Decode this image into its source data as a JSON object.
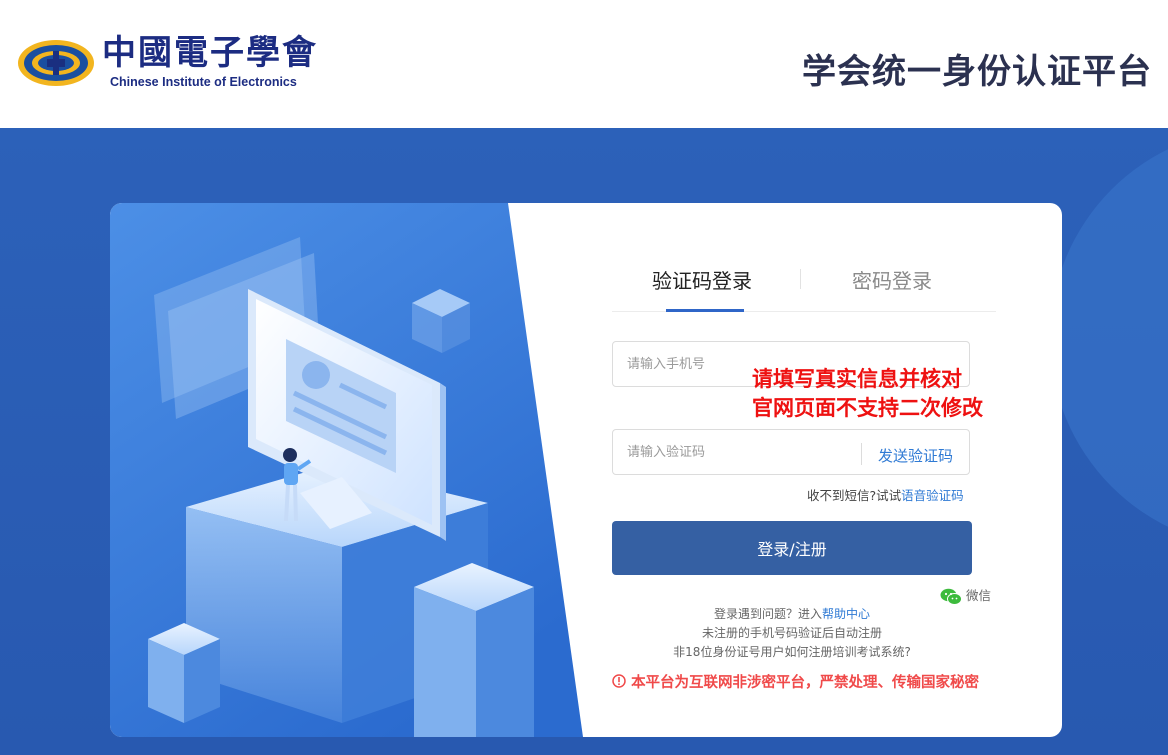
{
  "header": {
    "logo_cn": "中國電子學會",
    "logo_en": "Chinese Institute of Electronics",
    "platform_title": "学会统一身份认证平台"
  },
  "tabs": {
    "sms_login": "验证码登录",
    "password_login": "密码登录"
  },
  "form": {
    "phone_placeholder": "请输入手机号",
    "code_placeholder": "请输入验证码",
    "send_code": "发送验证码",
    "sms_help_prefix": "收不到短信?试试",
    "sms_help_link": "语音验证码",
    "login_button": "登录/注册",
    "wechat": "微信"
  },
  "notice": {
    "line1": "请填写真实信息并核对",
    "line2": "官网页面不支持二次修改"
  },
  "help": {
    "line1_prefix": "登录遇到问题？进入",
    "line1_link": "帮助中心",
    "line2": "未注册的手机号码验证后自动注册",
    "line3": "非18位身份证号用户如何注册培训考试系统?"
  },
  "warning": "本平台为互联网非涉密平台，严禁处理、传输国家秘密",
  "colors": {
    "brand_blue": "#2c61b9",
    "button_blue": "#3560a3",
    "link_blue": "#2f7ad4",
    "notice_red": "#ee1111",
    "warning_red": "#f04a4a"
  }
}
